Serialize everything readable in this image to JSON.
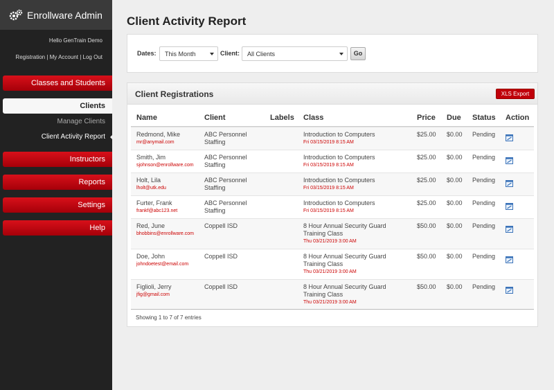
{
  "app": {
    "title": "Enrollware Admin",
    "brand_icon": "gears-icon"
  },
  "user": {
    "greeting": "Hello GenTrain Demo"
  },
  "account_links": {
    "registration": "Registration",
    "my_account": "My Account",
    "logout": "Log Out",
    "separator": " | "
  },
  "nav": {
    "classes_students": "Classes and Students",
    "clients": "Clients",
    "manage_clients": "Manage Clients",
    "client_activity_report": "Client Activity Report",
    "instructors": "Instructors",
    "reports": "Reports",
    "settings": "Settings",
    "help": "Help"
  },
  "page": {
    "title": "Client Activity Report"
  },
  "filters": {
    "dates_label": "Dates:",
    "dates_value": "This Month",
    "client_label": "Client:",
    "client_value": "All Clients",
    "go_label": "Go"
  },
  "panel": {
    "title": "Client Registrations",
    "export_label": "XLS Export"
  },
  "table": {
    "headers": {
      "name": "Name",
      "client": "Client",
      "labels": "Labels",
      "class": "Class",
      "price": "Price",
      "due": "Due",
      "status": "Status",
      "action": "Action"
    },
    "rows": [
      {
        "name": "Redmond, Mike",
        "email": "mr@anymail.com",
        "client": "ABC Personnel Staffing",
        "labels": "",
        "class": "Introduction to Computers",
        "date": "Fri 03/15/2019 8:15 AM",
        "price": "$25.00",
        "due": "$0.00",
        "status": "Pending"
      },
      {
        "name": "Smith, Jim",
        "email": "sjohnson@enrollware.com",
        "client": "ABC Personnel Staffing",
        "labels": "",
        "class": "Introduction to Computers",
        "date": "Fri 03/15/2019 8:15 AM",
        "price": "$25.00",
        "due": "$0.00",
        "status": "Pending"
      },
      {
        "name": "Holt, Lila",
        "email": "lholt@utk.edu",
        "client": "ABC Personnel Staffing",
        "labels": "",
        "class": "Introduction to Computers",
        "date": "Fri 03/15/2019 8:15 AM",
        "price": "$25.00",
        "due": "$0.00",
        "status": "Pending"
      },
      {
        "name": "Furter, Frank",
        "email": "frankf@abc123.net",
        "client": "ABC Personnel Staffing",
        "labels": "",
        "class": "Introduction to Computers",
        "date": "Fri 03/15/2019 8:15 AM",
        "price": "$25.00",
        "due": "$0.00",
        "status": "Pending"
      },
      {
        "name": "Red, June",
        "email": "bhobbins@enrollware.com",
        "client": "Coppell ISD",
        "labels": "",
        "class": "8 Hour Annual Security Guard Training Class",
        "date": "Thu 03/21/2019 3:00 AM",
        "price": "$50.00",
        "due": "$0.00",
        "status": "Pending"
      },
      {
        "name": "Doe, John",
        "email": "johndoetest@email.com",
        "client": "Coppell ISD",
        "labels": "",
        "class": "8 Hour Annual Security Guard Training Class",
        "date": "Thu 03/21/2019 3:00 AM",
        "price": "$50.00",
        "due": "$0.00",
        "status": "Pending"
      },
      {
        "name": "Figlioli, Jerry",
        "email": "jfig@gmail.com",
        "client": "Coppell ISD",
        "labels": "",
        "class": "8 Hour Annual Security Guard Training Class",
        "date": "Thu 03/21/2019 3:00 AM",
        "price": "$50.00",
        "due": "$0.00",
        "status": "Pending"
      }
    ],
    "action_icon": "edit-icon",
    "info": "Showing 1 to 7 of 7 entries"
  },
  "colors": {
    "accent_red": "#c0000a",
    "sidebar_bg": "#222222",
    "link_red": "#cc0000"
  }
}
